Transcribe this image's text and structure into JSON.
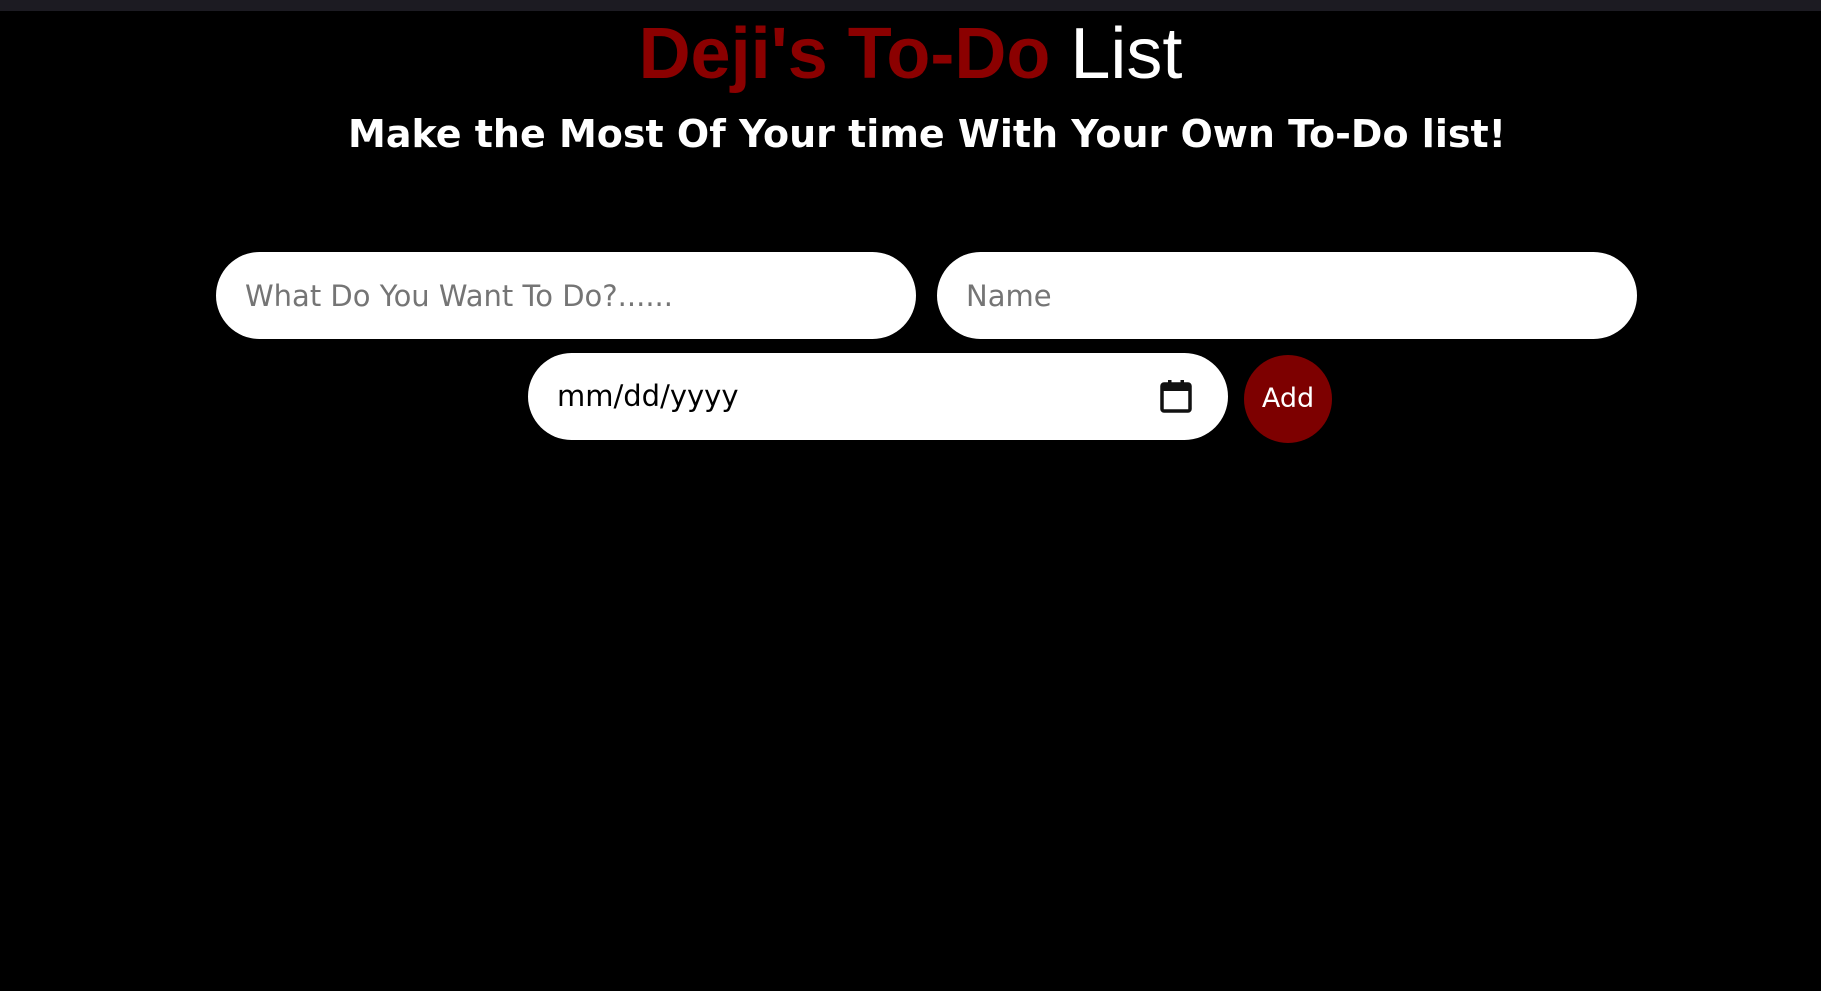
{
  "header": {
    "title_accent": "Deji's To-Do",
    "title_rest": "List",
    "subtitle": "Make the Most Of Your time With Your Own To-Do list!"
  },
  "form": {
    "task_input": {
      "placeholder": "What Do You Want To Do?......",
      "value": ""
    },
    "name_input": {
      "placeholder": "Name",
      "value": ""
    },
    "date_input": {
      "display": "mm/dd/yyyy",
      "icon": "calendar-icon"
    },
    "add_button_label": "Add"
  },
  "colors": {
    "background": "#000000",
    "accent": "#8b0000",
    "button": "#7d0000",
    "field_background": "#ffffff",
    "placeholder": "#757575"
  }
}
